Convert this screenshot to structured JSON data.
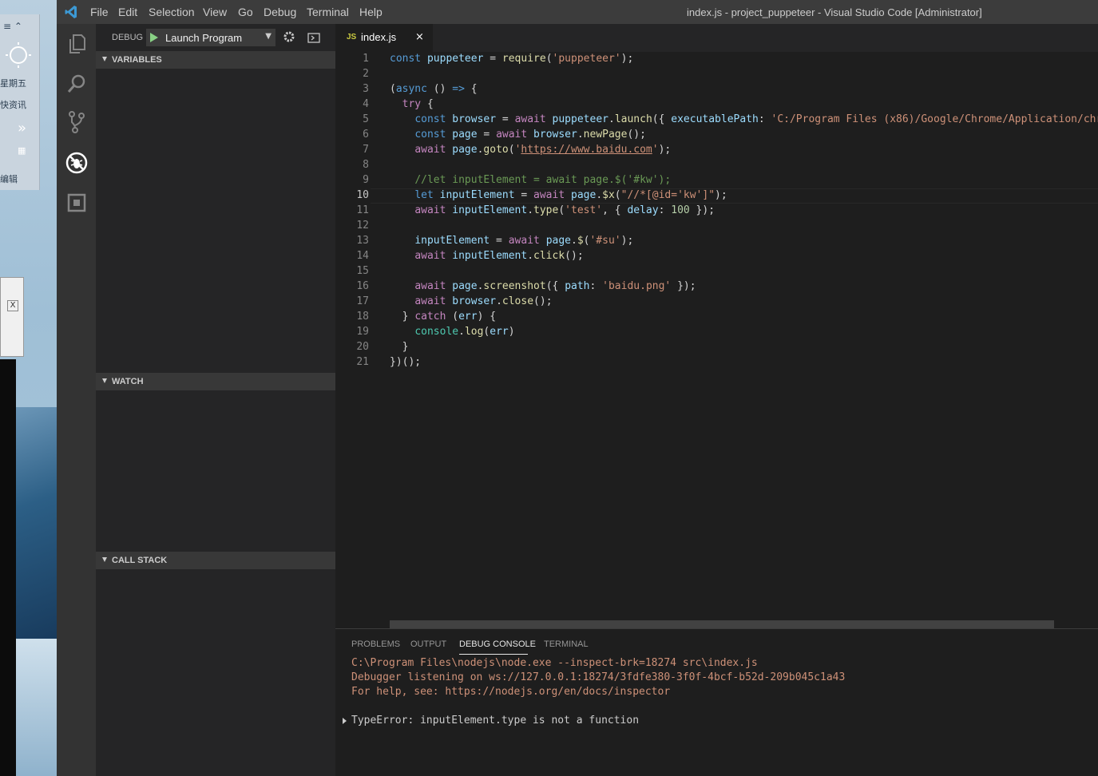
{
  "window": {
    "title": "index.js - project_puppeteer - Visual Studio Code [Administrator]",
    "menu": [
      "File",
      "Edit",
      "Selection",
      "View",
      "Go",
      "Debug",
      "Terminal",
      "Help"
    ]
  },
  "desktop": {
    "widget_day": "星期五",
    "widget_news": "快资讯",
    "widget_edit": "编辑",
    "win_close": "X"
  },
  "activity_bar": {
    "items": [
      "explorer-icon",
      "search-icon",
      "source-control-icon",
      "debug-icon",
      "extensions-icon"
    ],
    "active": "debug-icon"
  },
  "sidebar": {
    "debug_label": "DEBUG",
    "launch_config": "Launch Program",
    "sections": {
      "variables": "VARIABLES",
      "watch": "WATCH",
      "call_stack": "CALL STACK"
    }
  },
  "editor": {
    "tab": {
      "icon": "JS",
      "name": "index.js",
      "close": "×"
    },
    "active_line": 10,
    "line_numbers": [
      "1",
      "2",
      "3",
      "4",
      "5",
      "6",
      "7",
      "8",
      "9",
      "10",
      "11",
      "12",
      "13",
      "14",
      "15",
      "16",
      "17",
      "18",
      "19",
      "20",
      "21"
    ]
  },
  "panel": {
    "tabs": [
      "PROBLEMS",
      "OUTPUT",
      "DEBUG CONSOLE",
      "TERMINAL"
    ],
    "active_tab": "DEBUG CONSOLE",
    "console_lines": [
      "C:\\Program Files\\nodejs\\node.exe --inspect-brk=18274 src\\index.js",
      "Debugger listening on ws://127.0.0.1:18274/3fdfe380-3f0f-4bcf-b52d-209b045c1a43",
      "For help, see: https://nodejs.org/en/docs/inspector"
    ],
    "error_line": "TypeError: inputElement.type is not a function"
  },
  "colors": {
    "titlebar": "#3c3c3c",
    "activitybar": "#333333",
    "sidebar": "#252526",
    "editor": "#1e1e1e",
    "keyword": "#569cd6",
    "control": "#c586c0",
    "string": "#ce9178",
    "comment": "#6a9955"
  }
}
